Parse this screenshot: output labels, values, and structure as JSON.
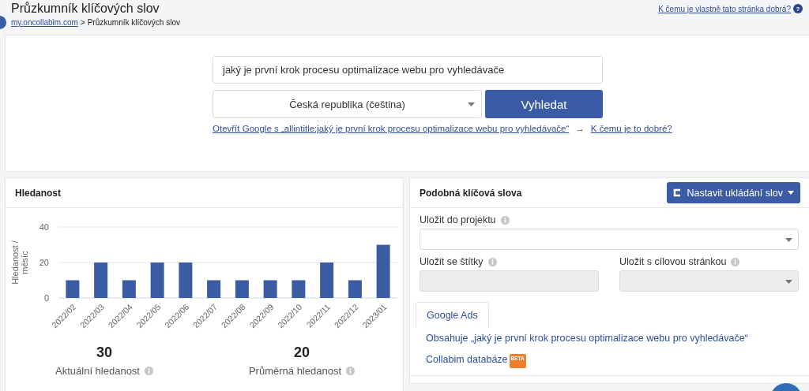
{
  "header": {
    "title": "Průzkumník klíčových slov",
    "breadcrumb": {
      "link": "my.oncollabim.com",
      "separator": ">",
      "current": "Průzkumník klíčových slov"
    },
    "help_link": "K čemu je vlastně tato stránka dobrá?",
    "help_icon": "?"
  },
  "search": {
    "query": "jaký je první krok procesu optimalizace webu pro vyhledávače",
    "country": "Česká republika (čeština)",
    "button": "Vyhledat",
    "google_link": "Otevřít Google s „allintitle:jaký je první krok procesu optimalizace webu pro vyhledávače“",
    "arrow": "→",
    "help_link": "K čemu je to dobré?"
  },
  "volume": {
    "title": "Hledanost",
    "chart_data": {
      "type": "bar",
      "ylabel": "Hledanost / měsíc",
      "categories": [
        "2022/02",
        "2022/03",
        "2022/04",
        "2022/05",
        "2022/06",
        "2022/07",
        "2022/08",
        "2022/09",
        "2022/10",
        "2022/11",
        "2022/12",
        "2023/01"
      ],
      "series": [
        {
          "color": "#3b5ba5",
          "values": [
            10,
            20,
            10,
            20,
            20,
            10,
            10,
            10,
            10,
            20,
            10,
            30
          ]
        }
      ],
      "ylim": [
        0,
        40
      ],
      "yticks": [
        0,
        20,
        40
      ]
    },
    "stats": [
      {
        "value": "30",
        "label": "Aktuální hledanost"
      },
      {
        "value": "20",
        "label": "Průměrná hledanost"
      }
    ]
  },
  "similar": {
    "title": "Podobná klíčová slova",
    "settings_button": "Nastavit ukládání slov",
    "fields": [
      {
        "label": "Uložit do projektu",
        "kind": "select",
        "disabled": false
      },
      {
        "label": "Uložit se štítky",
        "kind": "text",
        "disabled": true
      },
      {
        "label": "Uložit s cílovou stránkou",
        "kind": "select",
        "disabled": true
      }
    ],
    "tabs": [
      {
        "label": "Google Ads",
        "selected": true
      }
    ],
    "sources": [
      {
        "label": "Obsahuje „jaký je první krok procesu optimalizace webu pro vyhledávače“"
      },
      {
        "label": "Collabim databáze",
        "badge": "BETA"
      }
    ]
  }
}
